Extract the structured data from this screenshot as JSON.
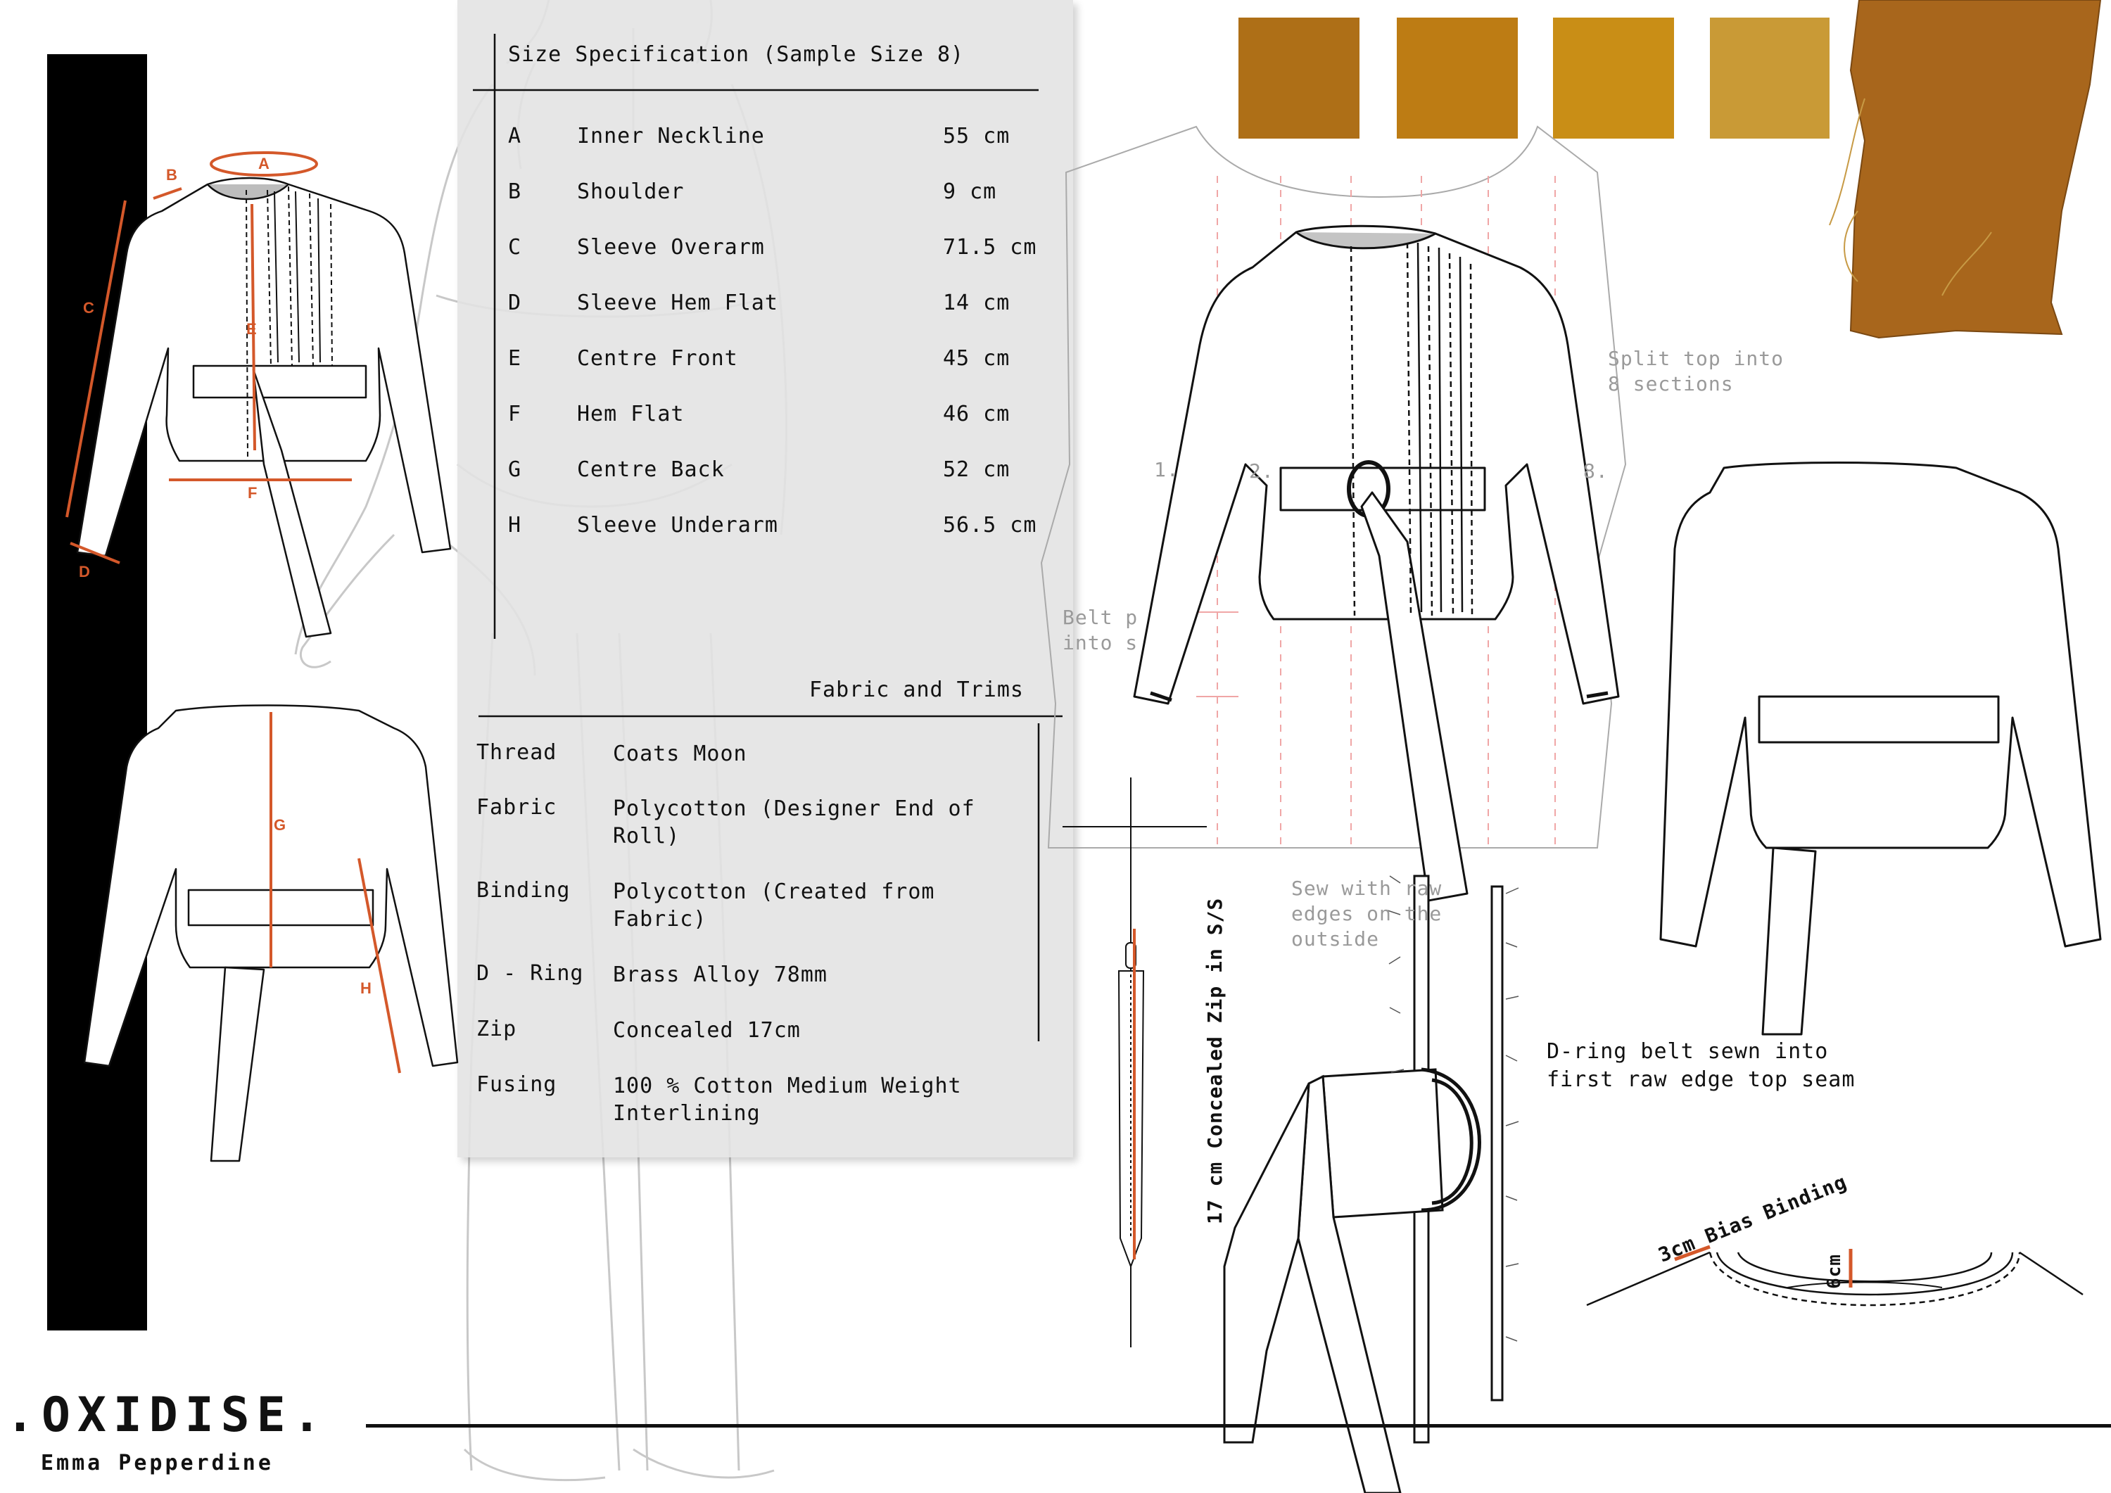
{
  "spec_table": {
    "title": "Size Specification (Sample Size 8)",
    "rows": [
      {
        "code": "A",
        "name": "Inner Neckline",
        "value": "55 cm"
      },
      {
        "code": "B",
        "name": "Shoulder",
        "value": "9 cm"
      },
      {
        "code": "C",
        "name": "Sleeve Overarm",
        "value": "71.5 cm"
      },
      {
        "code": "D",
        "name": "Sleeve Hem Flat",
        "value": "14 cm"
      },
      {
        "code": "E",
        "name": "Centre Front",
        "value": "45 cm"
      },
      {
        "code": "F",
        "name": "Hem Flat",
        "value": "46 cm"
      },
      {
        "code": "G",
        "name": "Centre Back",
        "value": "52 cm"
      },
      {
        "code": "H",
        "name": "Sleeve Underarm",
        "value": "56.5 cm"
      }
    ]
  },
  "trims": {
    "title": "Fabric and Trims",
    "rows": [
      {
        "label": "Thread",
        "value": "Coats Moon"
      },
      {
        "label": "Fabric",
        "value": "Polycotton (Designer End of Roll)"
      },
      {
        "label": "Binding",
        "value": "Polycotton (Created from Fabric)"
      },
      {
        "label": "D - Ring",
        "value": "Brass Alloy 78mm"
      },
      {
        "label": "Zip",
        "value": "Concealed 17cm"
      },
      {
        "label": "Fusing",
        "value": "100 % Cotton Medium Weight Interlining"
      }
    ]
  },
  "measure_labels": [
    "A",
    "B",
    "C",
    "D",
    "E",
    "F",
    "G",
    "H"
  ],
  "notes": {
    "split_top": "Split top into\n8 sections",
    "belt_partial": "Belt p\ninto s",
    "sew_raw_edges": "Sew with raw\nedges on the\noutside",
    "section_numbers": [
      "1.",
      "2.",
      "8."
    ],
    "dring_belt": "D-ring belt sewn into\nfirst raw edge top seam",
    "zip_label": "17 cm Concealed Zip in S/S",
    "bias_binding": "3cm Bias Binding",
    "bias_depth": "6cm"
  },
  "swatches": [
    "#ae6f17",
    "#bd7c14",
    "#c98e16",
    "#c99a36"
  ],
  "fabric_sample_color": "#a8661c",
  "accent_color": "#d4582a",
  "brand": {
    "name": ".OXIDISE.",
    "designer": "Emma Pepperdine"
  }
}
